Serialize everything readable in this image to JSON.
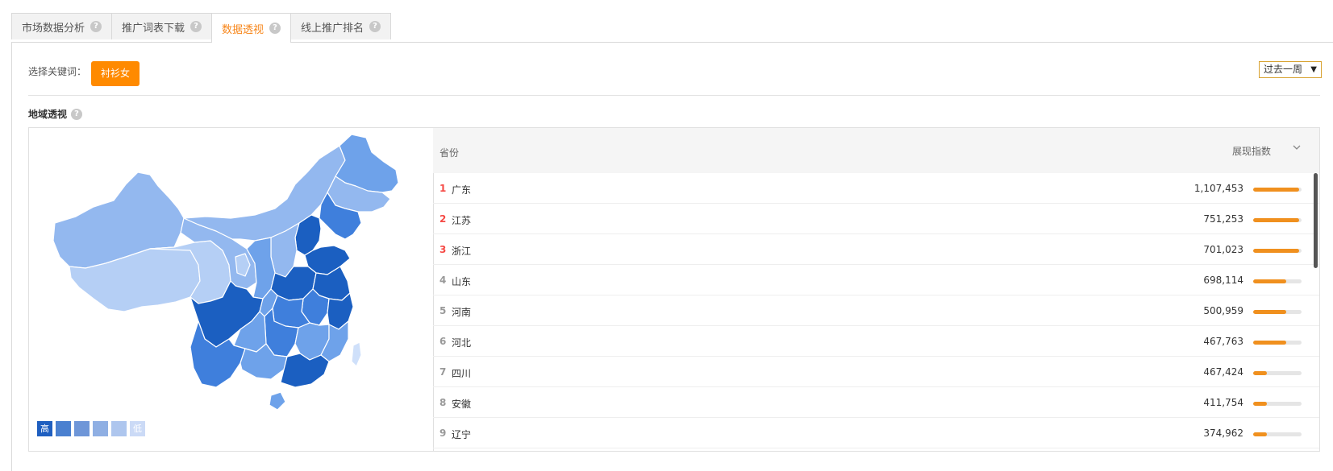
{
  "tabs": [
    {
      "label": "市场数据分析",
      "active": false
    },
    {
      "label": "推广词表下载",
      "active": false
    },
    {
      "label": "数据透视",
      "active": true
    },
    {
      "label": "线上推广排名",
      "active": false
    }
  ],
  "help_glyph": "?",
  "keyword": {
    "label": "选择关键词：",
    "chip": "衬衫女"
  },
  "period": {
    "selected": "过去一周",
    "arrow": "▼"
  },
  "section": {
    "title": "地域透视"
  },
  "legend": {
    "high": "高",
    "low": "低",
    "colors": [
      "#1f5fc0",
      "#4a80d0",
      "#6e96d8",
      "#8fafe3",
      "#aec6ee",
      "#cbdaf6"
    ]
  },
  "map": {
    "colors": {
      "darkest": "#1b5fc1",
      "dark": "#3f7fdc",
      "mid": "#6ea2ea",
      "light": "#93b8ef",
      "lighter": "#b5cff5",
      "lightest": "#cfe0fa"
    }
  },
  "table": {
    "header": {
      "province": "省份",
      "index": "展现指数",
      "sort_icon": "chevron-down-icon"
    },
    "rows": [
      {
        "rank": "1",
        "province": "广东",
        "value": "1,107,453",
        "level": 0.95
      },
      {
        "rank": "2",
        "province": "江苏",
        "value": "751,253",
        "level": 0.95
      },
      {
        "rank": "3",
        "province": "浙江",
        "value": "701,023",
        "level": 0.95
      },
      {
        "rank": "4",
        "province": "山东",
        "value": "698,114",
        "level": 0.68
      },
      {
        "rank": "5",
        "province": "河南",
        "value": "500,959",
        "level": 0.68
      },
      {
        "rank": "6",
        "province": "河北",
        "value": "467,763",
        "level": 0.68
      },
      {
        "rank": "7",
        "province": "四川",
        "value": "467,424",
        "level": 0.28
      },
      {
        "rank": "8",
        "province": "安徽",
        "value": "411,754",
        "level": 0.28
      },
      {
        "rank": "9",
        "province": "辽宁",
        "value": "374,962",
        "level": 0.28
      }
    ]
  }
}
